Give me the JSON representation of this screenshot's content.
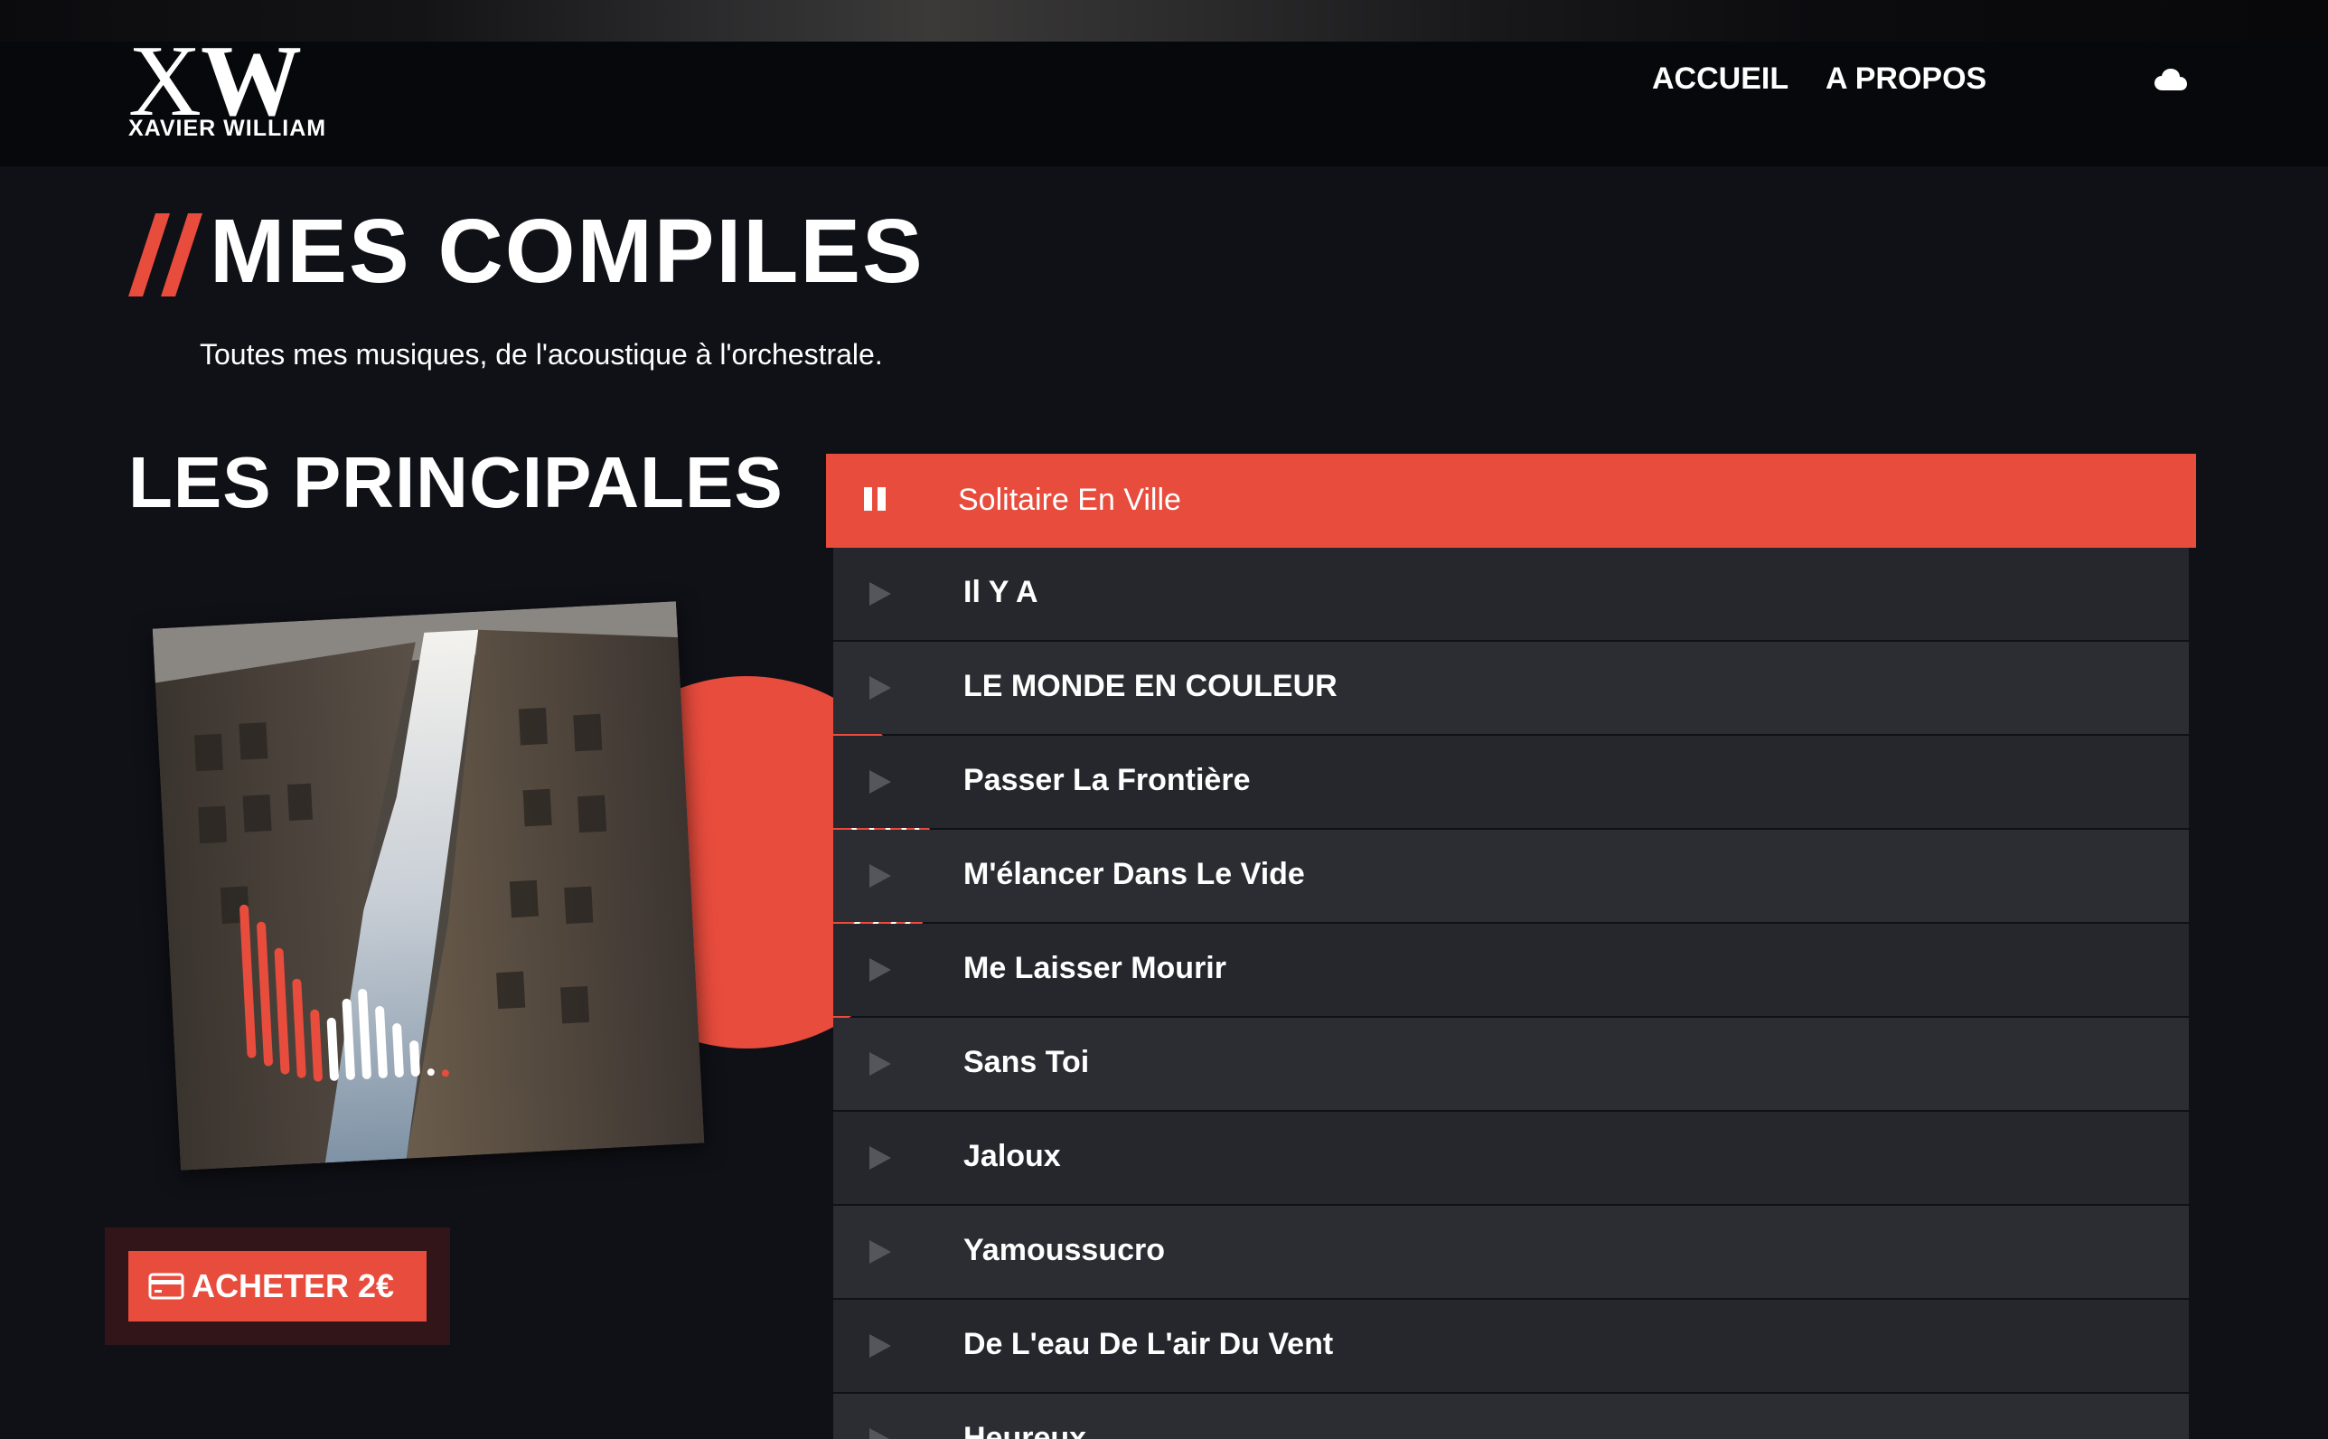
{
  "header": {
    "logo": {
      "mark_x": "X",
      "mark_w": "W",
      "name": "XAVIER WILLIAM"
    },
    "nav": [
      {
        "label": "ACCUEIL"
      },
      {
        "label": "A PROPOS"
      }
    ],
    "cloud_icon": "cloud-icon"
  },
  "page": {
    "title": "MES COMPILES",
    "subtitle": "Toutes mes musiques, de l'acoustique à l'orchestrale.",
    "accent_color": "#e84c3d"
  },
  "album": {
    "section_title": "LES PRINCIPALES",
    "buy_label": "ACHETER 2€",
    "buy_icon": "credit-card-icon"
  },
  "playlist": {
    "tracks": [
      {
        "title": "Solitaire En Ville",
        "state": "playing",
        "icon": "pause-icon"
      },
      {
        "title": "Il Y A",
        "state": "idle",
        "icon": "play-icon"
      },
      {
        "title": "LE MONDE EN COULEUR",
        "state": "idle",
        "icon": "play-icon"
      },
      {
        "title": "Passer La Frontière",
        "state": "idle",
        "icon": "play-icon"
      },
      {
        "title": "M'élancer Dans Le Vide",
        "state": "idle",
        "icon": "play-icon"
      },
      {
        "title": "Me Laisser Mourir",
        "state": "idle",
        "icon": "play-icon"
      },
      {
        "title": "Sans Toi",
        "state": "idle",
        "icon": "play-icon"
      },
      {
        "title": "Jaloux",
        "state": "idle",
        "icon": "play-icon"
      },
      {
        "title": "Yamoussucro",
        "state": "idle",
        "icon": "play-icon"
      },
      {
        "title": "De L'eau De L'air Du Vent",
        "state": "idle",
        "icon": "play-icon"
      },
      {
        "title": "Heureux",
        "state": "idle",
        "icon": "play-icon"
      }
    ]
  }
}
